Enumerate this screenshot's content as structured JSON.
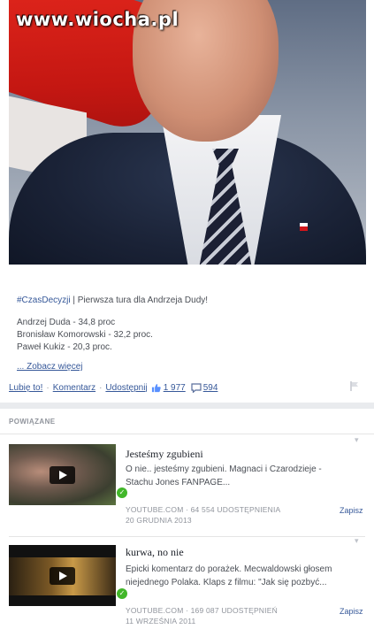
{
  "watermark": "www.wiocha.pl",
  "post": {
    "headline_tag": "#CzasDecyzji",
    "headline_text": " | Pierwsza tura dla Andrzeja Dudy!",
    "results": [
      "Andrzej Duda - 34,8 proc",
      "Bronisław Komorowski - 32,2 proc.",
      "Paweł Kukiz - 20,3 proc."
    ],
    "see_more": "... Zobacz więcej",
    "actions": {
      "like": "Lubię to!",
      "comment": "Komentarz",
      "share": "Udostępnij",
      "like_count": "1 977",
      "comment_count": "594",
      "separator": "·"
    }
  },
  "related": {
    "title": "POWIĄZANE",
    "items": [
      {
        "title": "Jesteśmy zgubieni",
        "desc_line1": "O nie.. jesteśmy zgubieni. Magnaci i Czarodzieje -",
        "desc_line2": "Stachu Jones FANPAGE...",
        "meta_line1": "YOUTUBE.COM · 64 554 UDOSTĘPNIENIA",
        "meta_line2": "20 GRUDNIA 2013",
        "save": "Zapisz"
      },
      {
        "title": "kurwa, no nie",
        "desc_line1": "Epicki komentarz do porażek. Mecwaldowski głosem",
        "desc_line2": "niejednego Polaka. Klaps z filmu: \"Jak się pozbyć...",
        "meta_line1": "YOUTUBE.COM · 169 087 UDOSTĘPNIEŃ",
        "meta_line2": "11 WRZEŚNIA 2011",
        "save": "Zapisz"
      }
    ]
  },
  "icons": {
    "like": "thumbs-up-icon",
    "comment": "comment-bubble-icon",
    "report": "flag-icon",
    "play": "play-icon",
    "verified": "check-badge-icon",
    "menu": "chevron-down-icon"
  },
  "colors": {
    "link": "#365899",
    "muted": "#90949c",
    "verified": "#42b72a"
  }
}
